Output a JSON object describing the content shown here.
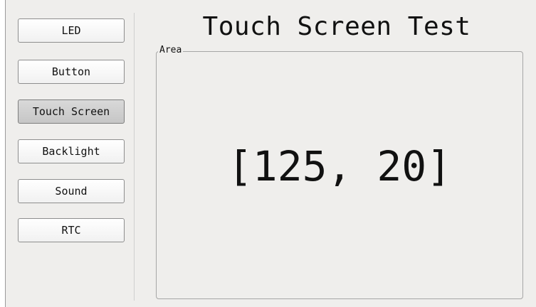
{
  "sidebar": {
    "items": [
      {
        "label": "LED"
      },
      {
        "label": "Button"
      },
      {
        "label": "Touch Screen"
      },
      {
        "label": "Backlight"
      },
      {
        "label": "Sound"
      },
      {
        "label": "RTC"
      }
    ],
    "active_item": "Touch Screen"
  },
  "main": {
    "title": "Touch Screen Test",
    "area": {
      "legend": "Area",
      "coordinates": "[125, 20]"
    }
  }
}
